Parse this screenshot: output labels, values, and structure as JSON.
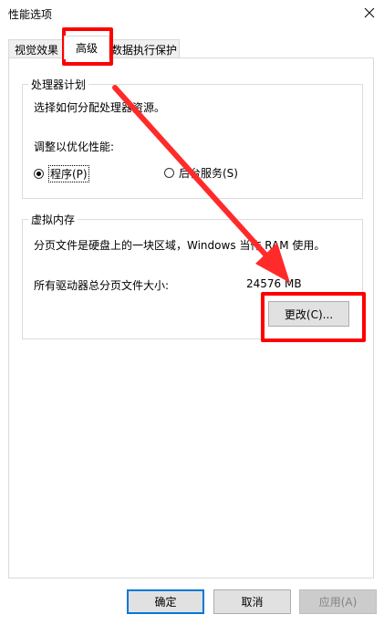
{
  "window": {
    "title": "性能选项"
  },
  "tabs": [
    {
      "label": "视觉效果"
    },
    {
      "label": "高级"
    },
    {
      "label": "数据执行保护"
    }
  ],
  "processor": {
    "legend": "处理器计划",
    "description": "选择如何分配处理器资源。",
    "adjust_label": "调整以优化性能:",
    "options": [
      {
        "label": "程序(P)",
        "selected": true
      },
      {
        "label": "后台服务(S)",
        "selected": false
      }
    ]
  },
  "virtual_memory": {
    "legend": "虚拟内存",
    "description": "分页文件是硬盘上的一块区域，Windows 当作 RAM 使用。",
    "total_label": "所有驱动器总分页文件大小:",
    "total_value": "24576 MB",
    "change_button": "更改(C)..."
  },
  "footer": {
    "ok": "确定",
    "cancel": "取消",
    "apply": "应用(A)"
  },
  "colors": {
    "annotation": "#ff0000",
    "focus_border": "#0078d7"
  },
  "icons": {
    "close": "close-icon"
  }
}
